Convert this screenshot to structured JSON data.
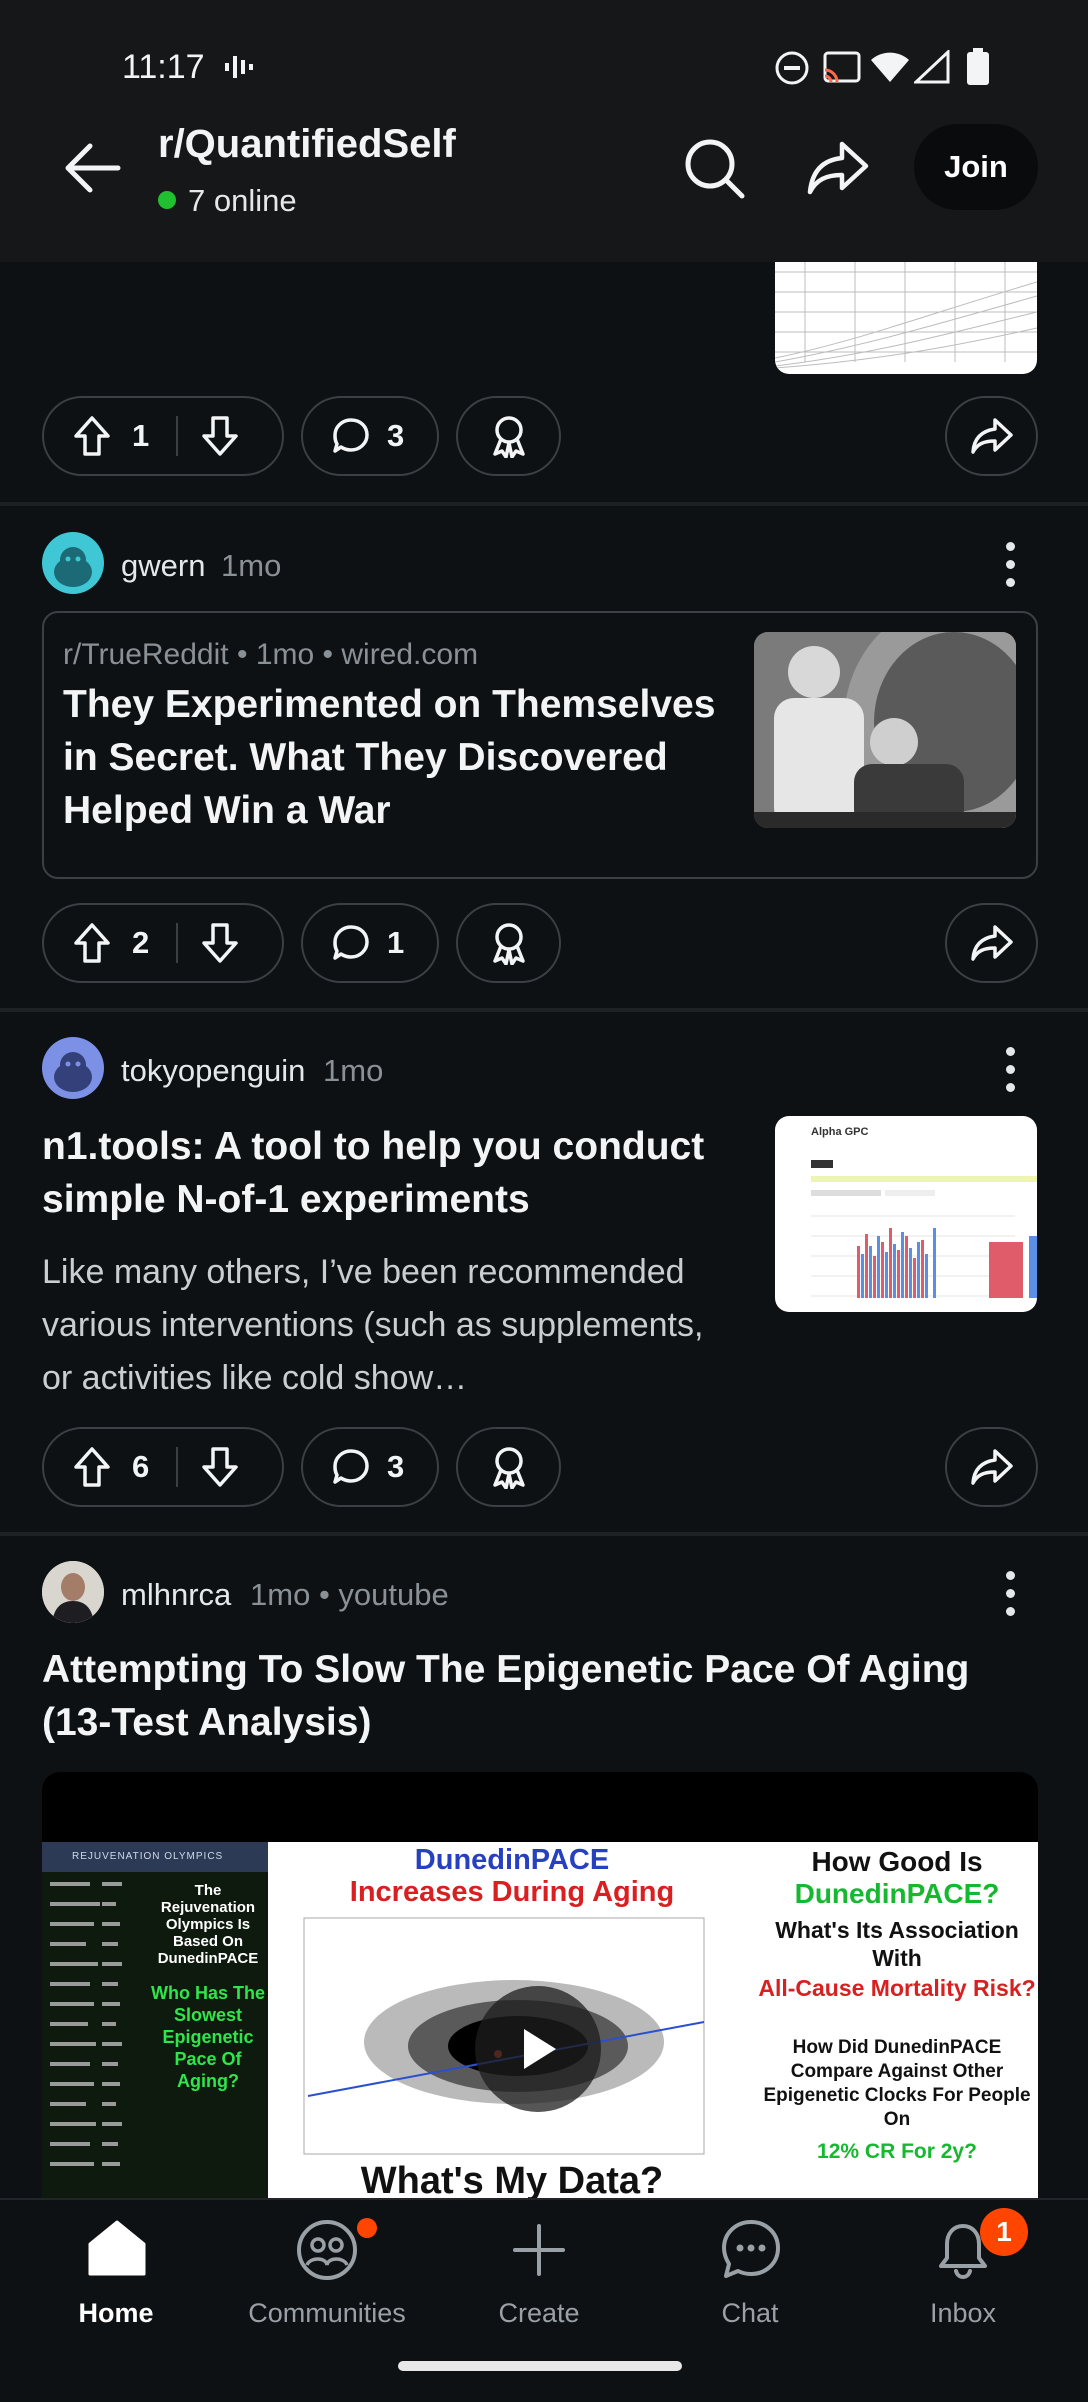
{
  "status_bar": {
    "time": "11:17"
  },
  "header": {
    "subreddit": "r/QuantifiedSelf",
    "online": "7 online",
    "join_label": "Join"
  },
  "posts": [
    {
      "upvotes": "1",
      "comments": "3"
    },
    {
      "author": "gwern",
      "age": "1mo",
      "link": {
        "source_sub": "r/TrueReddit",
        "source_age": "1mo",
        "domain": "wired.com",
        "title": "They Experimented on Themselves in Secret. What They Discovered Helped Win a War"
      },
      "upvotes": "2",
      "comments": "1"
    },
    {
      "author": "tokyopenguin",
      "age": "1mo",
      "title": "n1.tools: A tool to help you conduct simple N-of-1 experiments",
      "body": "Like many others, I’ve been recommended various interventions (such as supplements, or activities like cold show…",
      "thumb_title": "Alpha GPC",
      "upvotes": "6",
      "comments": "3"
    },
    {
      "author": "mlhnrca",
      "age": "1mo",
      "source": "youtube",
      "title": "Attempting To Slow The Epigenetic Pace Of Aging (13-Test Analysis)",
      "video": {
        "left_logo": "REJUVENATION OLYMPICS",
        "left_caption_1": "The Rejuvenation Olympics Is Based On DunedinPACE",
        "left_caption_2": "Who Has The Slowest Epigenetic Pace Of Aging?",
        "mid_title_1": "DunedinPACE",
        "mid_title_2": "Increases During Aging",
        "right_1": "How Good Is",
        "right_2": "DunedinPACE?",
        "right_3": "What's Its Association With",
        "right_4": "All-Cause Mortality Risk?",
        "right_5": "How Did DunedinPACE Compare Against Other Epigenetic Clocks For People On",
        "right_6": "12% CR For 2y?",
        "bottom": "What's My Data?"
      }
    }
  ],
  "bottom_nav": {
    "home": "Home",
    "communities": "Communities",
    "create": "Create",
    "chat": "Chat",
    "inbox": "Inbox",
    "inbox_badge": "1"
  },
  "colors": {
    "online": "#20c030",
    "badge": "#ff4500",
    "background": "#0e1113"
  }
}
